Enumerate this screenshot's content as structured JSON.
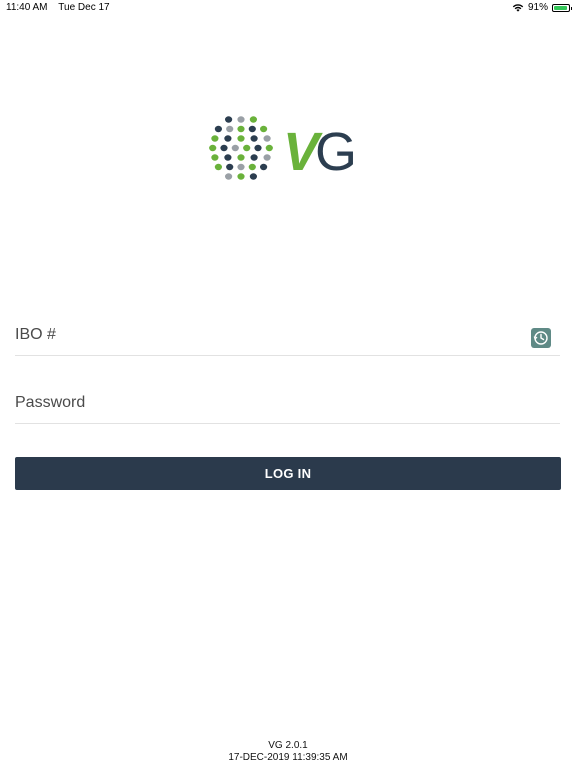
{
  "status_bar": {
    "time": "11:40 AM",
    "date": "Tue Dec 17",
    "battery_percent_label": "91%",
    "battery_level": 0.91
  },
  "logo": {
    "text": "VG",
    "colors": {
      "green": "#6ab23b",
      "navy": "#2c3e50",
      "gray": "#9aa0a6"
    }
  },
  "form": {
    "ibo_placeholder": "IBO #",
    "ibo_value": "",
    "password_placeholder": "Password",
    "password_value": "",
    "history_icon": "history-clock-icon",
    "login_label": "LOG IN"
  },
  "footer": {
    "version": "VG 2.0.1",
    "build_date": "17-DEC-2019 11:39:35 AM"
  },
  "colors": {
    "button_background": "#2b3a4c",
    "history_button_background": "#5f8a86"
  }
}
